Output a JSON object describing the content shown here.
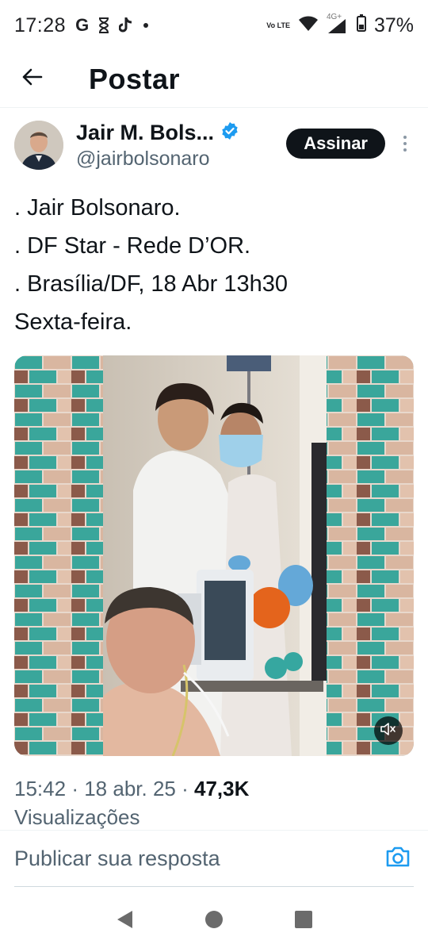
{
  "status_bar": {
    "time": "17:28",
    "icons_left": [
      "google-icon",
      "hourglass-icon",
      "tiktok-icon",
      "dot-icon"
    ],
    "network_label": "Vo LTE",
    "signal_label": "4G+",
    "battery": "37%"
  },
  "header": {
    "title": "Postar",
    "back_icon": "arrow-left-icon"
  },
  "author": {
    "name": "Jair M. Bols...",
    "handle": "@jairbolsonaro",
    "verified": true,
    "verified_color": "#1d9bf0",
    "subscribe_label": "Assinar"
  },
  "tweet": {
    "lines": [
      ". Jair Bolsonaro.",
      ". DF Star - Rede D’OR.",
      ". Brasília/DF, 18 Abr 13h30",
      "Sexta-feira."
    ]
  },
  "media": {
    "type": "video",
    "muted": true,
    "mute_icon": "volume-muted-icon"
  },
  "meta": {
    "time": "15:42",
    "separator": "·",
    "date": "18 abr. 25",
    "views_count": "47,3K",
    "views_label": "Visualizações"
  },
  "reply": {
    "placeholder": "Publicar sua resposta",
    "camera_icon": "camera-icon",
    "accent_color": "#1d9bf0"
  },
  "nav": {
    "back_icon": "triangle-back-icon",
    "home_icon": "circle-home-icon",
    "recents_icon": "square-recents-icon"
  }
}
